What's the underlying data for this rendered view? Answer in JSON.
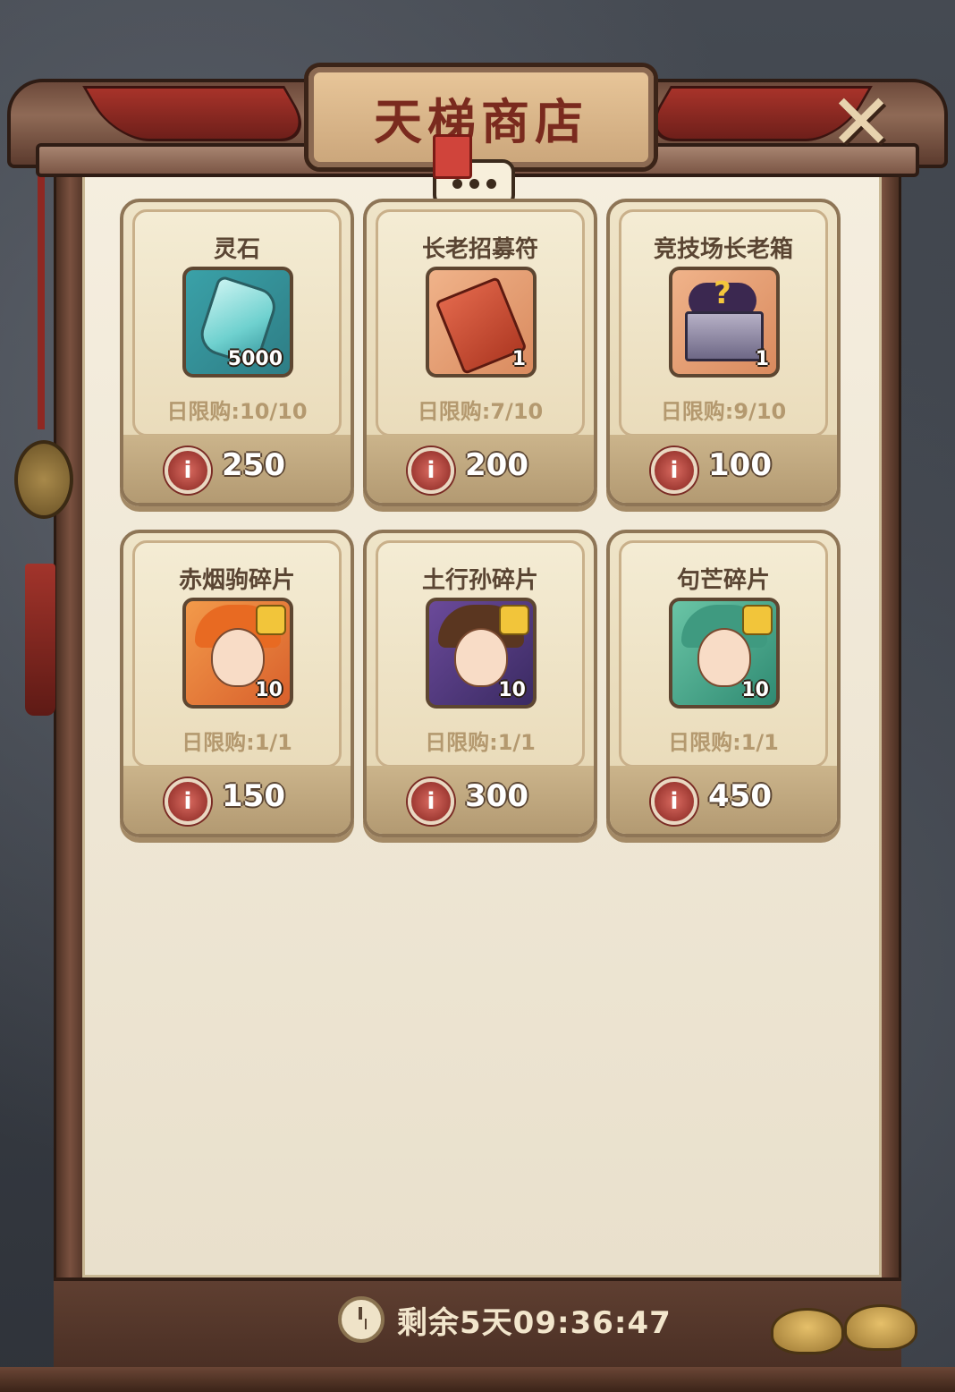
{
  "title": "天梯商店",
  "close_label": "✕",
  "items": [
    {
      "name": "灵石",
      "count": "5000",
      "limit": "日限购:10/10",
      "price": "250",
      "art": "spirit-stone"
    },
    {
      "name": "长老招募符",
      "count": "1",
      "limit": "日限购:7/10",
      "price": "200",
      "art": "elder-recruit-talisman"
    },
    {
      "name": "竞技场长老箱",
      "count": "1",
      "limit": "日限购:9/10",
      "price": "100",
      "art": "arena-elder-chest"
    },
    {
      "name": "赤烟驹碎片",
      "count": "10",
      "limit": "日限购:1/1",
      "price": "150",
      "art": "hero-shard"
    },
    {
      "name": "土行孙碎片",
      "count": "10",
      "limit": "日限购:1/1",
      "price": "300",
      "art": "hero-shard"
    },
    {
      "name": "句芒碎片",
      "count": "10",
      "limit": "日限购:1/1",
      "price": "450",
      "art": "hero-shard"
    }
  ],
  "currency_icon": "arena-token-icon",
  "countdown": "剩余5天09:36:47",
  "colors": {
    "accent": "#7a2a1e",
    "panel": "#f5eedf",
    "frame": "#6d4a3b"
  }
}
